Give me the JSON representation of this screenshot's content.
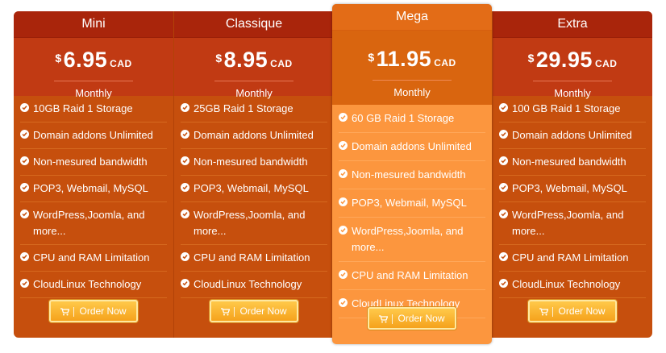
{
  "plans": [
    {
      "name": "Mini",
      "currency": "$",
      "price": "6.95",
      "code": "CAD",
      "period": "Monthly",
      "features": [
        "10GB Raid 1 Storage",
        "Domain addons Unlimited",
        "Non-mesured bandwidth",
        "POP3, Webmail, MySQL",
        "WordPress,Joomla, and more...",
        "CPU and RAM Limitation",
        "CloudLinux Technology"
      ],
      "button": "Order Now"
    },
    {
      "name": "Classique",
      "currency": "$",
      "price": "8.95",
      "code": "CAD",
      "period": "Monthly",
      "features": [
        "25GB Raid 1 Storage",
        "Domain addons Unlimited",
        "Non-mesured bandwidth",
        "POP3, Webmail, MySQL",
        "WordPress,Joomla, and more...",
        "CPU and RAM Limitation",
        "CloudLinux Technology"
      ],
      "button": "Order Now"
    },
    {
      "name": "Mega",
      "currency": "$",
      "price": "11.95",
      "code": "CAD",
      "period": "Monthly",
      "features": [
        "60 GB Raid 1 Storage",
        "Domain addons Unlimited",
        "Non-mesured bandwidth",
        "POP3, Webmail, MySQL",
        "WordPress,Joomla, and more...",
        "CPU and RAM Limitation",
        "CloudLinux Technology"
      ],
      "button": "Order Now"
    },
    {
      "name": "Extra",
      "currency": "$",
      "price": "29.95",
      "code": "CAD",
      "period": "Monthly",
      "features": [
        "100 GB Raid 1 Storage",
        "Domain addons Unlimited",
        "Non-mesured bandwidth",
        "POP3, Webmail, MySQL",
        "WordPress,Joomla, and more...",
        "CPU and RAM Limitation",
        "CloudLinux Technology"
      ],
      "button": "Order Now"
    }
  ],
  "icons": {
    "feature": "check-circle-icon",
    "button": "cart-icon"
  },
  "colors": {
    "header": "#a9250b",
    "price_box": "#c13a13",
    "body": "#c64f0d",
    "featured_body": "#fc963e",
    "button": "#f5a21c"
  }
}
